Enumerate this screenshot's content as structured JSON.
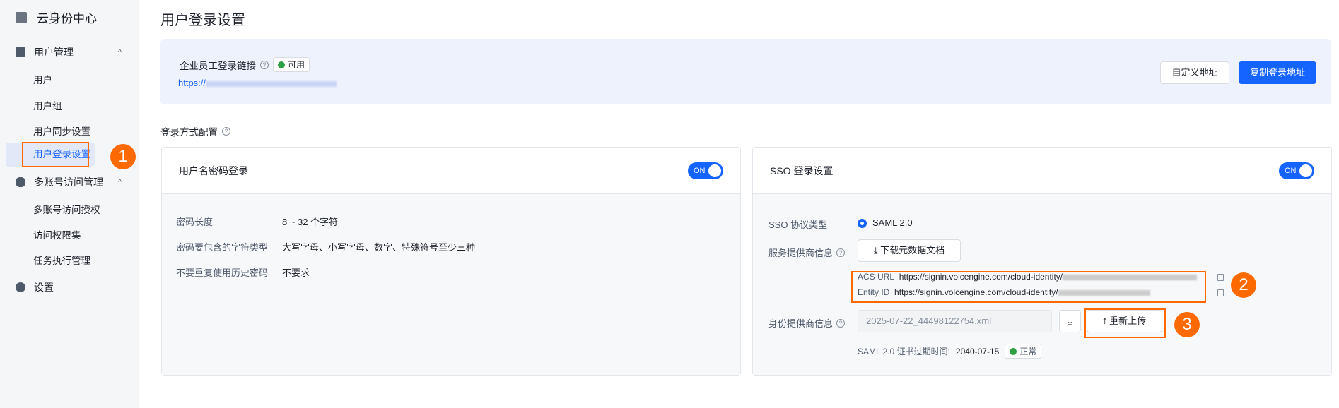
{
  "sidebar": {
    "brand": "云身份中心",
    "groups": [
      {
        "label": "用户管理",
        "items": [
          "用户",
          "用户组",
          "用户同步设置",
          "用户登录设置"
        ]
      },
      {
        "label": "多账号访问管理",
        "items": [
          "多账号访问授权",
          "访问权限集",
          "任务执行管理"
        ]
      },
      {
        "label": "设置"
      }
    ]
  },
  "page_title": "用户登录设置",
  "login_link": {
    "label": "企业员工登录链接",
    "status": "可用",
    "url_prefix": "https://",
    "custom_btn": "自定义地址",
    "copy_btn": "复制登录地址"
  },
  "section_title": "登录方式配置",
  "password_card": {
    "title": "用户名密码登录",
    "toggle": "ON",
    "rows": [
      {
        "k": "密码长度",
        "v": "8 ~ 32 个字符"
      },
      {
        "k": "密码要包含的字符类型",
        "v": "大写字母、小写字母、数字、特殊符号至少三种"
      },
      {
        "k": "不要重复使用历史密码",
        "v": "不要求"
      }
    ]
  },
  "sso_card": {
    "title": "SSO 登录设置",
    "toggle": "ON",
    "protocol_label": "SSO 协议类型",
    "protocol": "SAML 2.0",
    "sp_label": "服务提供商信息",
    "download_btn": "下载元数据文档",
    "acs_label": "ACS URL",
    "acs_url": "https://signin.volcengine.com/cloud-identity/",
    "entity_label": "Entity ID",
    "entity_url": "https://signin.volcengine.com/cloud-identity/",
    "idp_label": "身份提供商信息",
    "file": "2025-07-22_44498122754.xml",
    "reupload_btn": "重新上传",
    "cert_label": "SAML 2.0 证书过期时间:",
    "cert_date": "2040-07-15",
    "cert_status": "正常"
  },
  "markers": [
    "1",
    "2",
    "3"
  ],
  "colors": {
    "accent": "#1664ff",
    "highlight": "#ff6a00"
  }
}
